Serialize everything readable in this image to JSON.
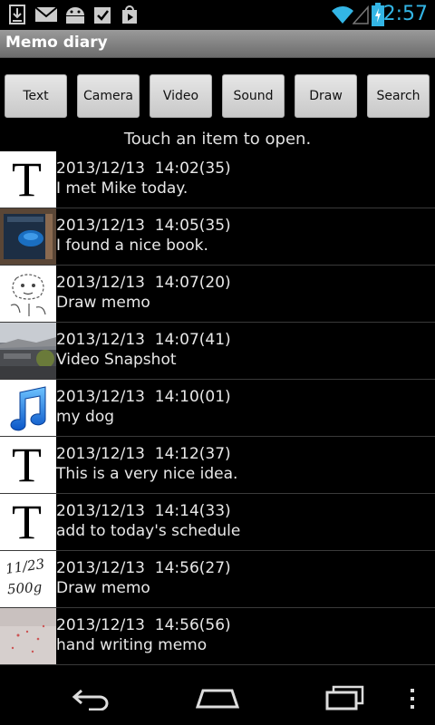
{
  "status": {
    "time": "2:57",
    "icons": [
      "download-icon",
      "gmail-icon",
      "android-icon",
      "clipboard-icon",
      "play-store-icon",
      "wifi-icon",
      "signal-icon",
      "battery-icon"
    ]
  },
  "app": {
    "title": "Memo diary"
  },
  "toolbar": {
    "buttons": [
      "Text",
      "Camera",
      "Video",
      "Sound",
      "Draw",
      "Search"
    ]
  },
  "hint": "Touch an item to open.",
  "memos": [
    {
      "timestamp": "2013/12/13  14:02(35)",
      "title": "I met Mike today.",
      "thumb": "text"
    },
    {
      "timestamp": "2013/12/13  14:05(35)",
      "title": "I found a nice book.",
      "thumb": "photo-book"
    },
    {
      "timestamp": "2013/12/13  14:07(20)",
      "title": "Draw memo",
      "thumb": "drawing"
    },
    {
      "timestamp": "2013/12/13  14:07(41)",
      "title": "Video Snapshot",
      "thumb": "photo-landscape"
    },
    {
      "timestamp": "2013/12/13  14:10(01)",
      "title": "my dog",
      "thumb": "music"
    },
    {
      "timestamp": "2013/12/13  14:12(37)",
      "title": "This is a very nice idea.",
      "thumb": "text"
    },
    {
      "timestamp": "2013/12/13  14:14(33)",
      "title": "add to today's schedule",
      "thumb": "text"
    },
    {
      "timestamp": "2013/12/13  14:56(27)",
      "title": "Draw memo",
      "thumb": "handwriting"
    },
    {
      "timestamp": "2013/12/13  14:56(56)",
      "title": "hand writing memo",
      "thumb": "photo-paper"
    }
  ],
  "thumb_text_glyph": "T",
  "handwriting_text": [
    "11/23",
    "500g"
  ],
  "colors": {
    "accent": "#33b5e5"
  }
}
